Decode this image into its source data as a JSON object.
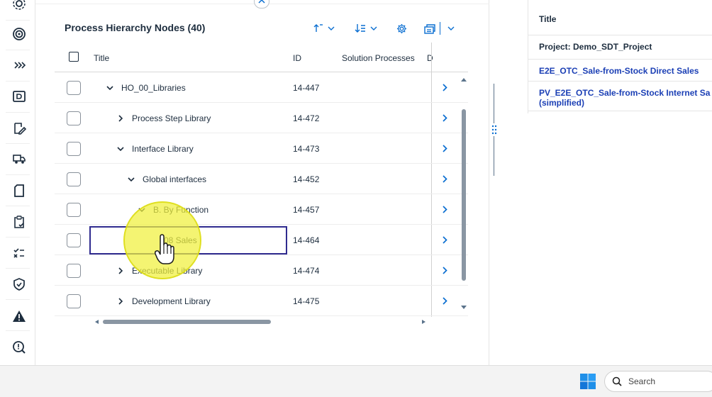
{
  "panel": {
    "title": "Process Hierarchy Nodes (40)"
  },
  "table": {
    "columns": [
      "Title",
      "ID",
      "Solution Processes",
      "D"
    ],
    "rows": [
      {
        "title": "HO_00_Libraries",
        "id": "14-447",
        "expander": "expanded",
        "level": 0
      },
      {
        "title": "Process Step Library",
        "id": "14-472",
        "expander": "collapsed",
        "level": 1
      },
      {
        "title": "Interface Library",
        "id": "14-473",
        "expander": "expanded",
        "level": 1
      },
      {
        "title": "Global interfaces",
        "id": "14-452",
        "expander": "expanded",
        "level": 2
      },
      {
        "title": "B. By Function",
        "id": "14-457",
        "expander": "expanded",
        "level": 3
      },
      {
        "title": "08 Sales",
        "id": "14-464",
        "expander": "none",
        "level": 4
      },
      {
        "title": "Executable Library",
        "id": "14-474",
        "expander": "collapsed",
        "level": 1
      },
      {
        "title": "Development Library",
        "id": "14-475",
        "expander": "collapsed",
        "level": 1
      }
    ]
  },
  "right_panel": {
    "header": "Title",
    "project": "Project: Demo_SDT_Project",
    "links": [
      "E2E_OTC_Sale-from-Stock Direct Sales",
      "PV_E2E_OTC_Sale-from-Stock Internet Sa",
      "(simplified)"
    ]
  },
  "taskbar": {
    "search_placeholder": "Search"
  },
  "colors": {
    "accent": "#0a6ed1",
    "link": "#1b3fb5",
    "selection_border": "#2f2b8f",
    "cursor_highlight": "#f0f03c"
  }
}
